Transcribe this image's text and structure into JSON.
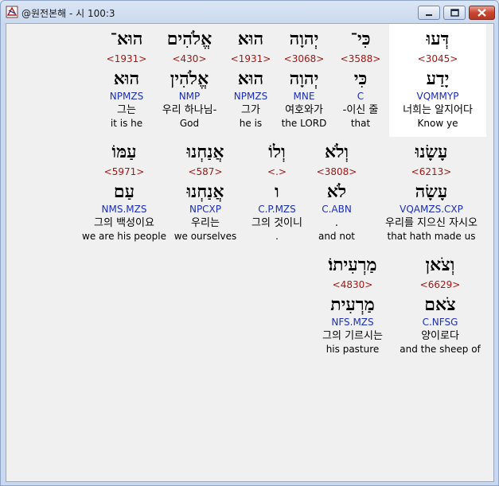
{
  "window": {
    "title": "@원전본해 - 시 100:3"
  },
  "colors": {
    "strong": "#a01818",
    "morph": "#1c2db8"
  },
  "rows": [
    {
      "words": [
        {
          "heb": "דְּעוּ",
          "num": "<3045>",
          "lemma": "יָדַע",
          "morph": "VQMMYP",
          "ko": "너희는 알지어다",
          "en": "Know ye"
        },
        {
          "heb": "כִּי־",
          "num": "<3588>",
          "lemma": "כִּי",
          "morph": "C",
          "ko": "-이신 줄",
          "en": "that"
        },
        {
          "heb": "יְהוָה",
          "num": "<3068>",
          "lemma": "יְהוָה",
          "morph": "MNE",
          "ko": "여호와가",
          "en": "the LORD"
        },
        {
          "heb": "הוּא",
          "num": "<1931>",
          "lemma": "הוּא",
          "morph": "NPMZS",
          "ko": "그가",
          "en": "he is"
        },
        {
          "heb": "אֱלֹהִים",
          "num": "<430>",
          "lemma": "אֱלֹהִין",
          "morph": "NMP",
          "ko": "우리 하나님-",
          "en": "God"
        },
        {
          "heb": "הוּא־",
          "num": "<1931>",
          "lemma": "הוּא",
          "morph": "NPMZS",
          "ko": "그는",
          "en": "it is he"
        }
      ]
    },
    {
      "words": [
        {
          "heb": "עָשָׂנוּ",
          "num": "<6213>",
          "lemma": "עָשָׂה",
          "morph": "VQAMZS.CXP",
          "ko": "우리를 지으신 자시오",
          "en": "that hath made us"
        },
        {
          "heb": "וְלֹא",
          "num": "<3808>",
          "lemma": "לֹא",
          "morph": "C.ABN",
          "ko": ".",
          "en": "and not"
        },
        {
          "heb": "וְלוֹ",
          "num": "<.>",
          "lemma": "ו",
          "morph": "C.P.MZS",
          "ko": "그의 것이니",
          "en": "."
        },
        {
          "heb": "אֲנַחְנוּ",
          "num": "<587>",
          "lemma": "אֲנַחְנוּ",
          "morph": "NPCXP",
          "ko": "우리는",
          "en": "we ourselves"
        },
        {
          "heb": "עַמּוֹ",
          "num": "<5971>",
          "lemma": "עַם",
          "morph": "NMS.MZS",
          "ko": "그의 백성이요",
          "en": "we are his people"
        }
      ]
    },
    {
      "words": [
        {
          "heb": "וְצֹאן",
          "num": "<6629>",
          "lemma": "צֹאם",
          "morph": "C.NFSG",
          "ko": "양이로다",
          "en": "and the sheep of"
        },
        {
          "heb": "מַרְעִיתוֹ׃",
          "num": "<4830>",
          "lemma": "מַרְעִית",
          "morph": "NFS.MZS",
          "ko": "그의 기르시는",
          "en": "his pasture"
        }
      ]
    }
  ]
}
